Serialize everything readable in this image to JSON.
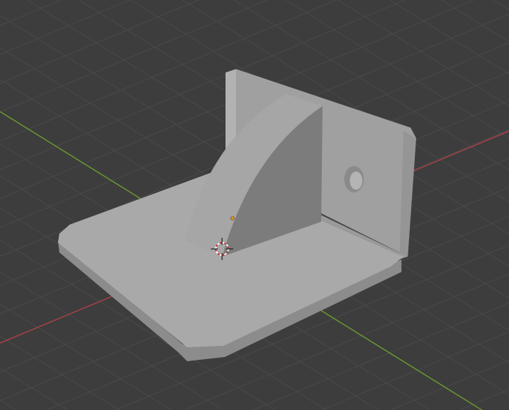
{
  "viewport": {
    "background_color": "#3d3d3d",
    "grid_color": "#4a4a4a",
    "x_axis_color": "#a8404a",
    "y_axis_color": "#6a9a30",
    "model_colors": {
      "top": "#a9a9a9",
      "side": "#8c8c8c",
      "wall": "#9e9e9e",
      "gusset_side": "#7c7c7c"
    },
    "origin_color": "#e8902a",
    "icons": [
      "origin-point-icon",
      "3d-cursor-icon"
    ]
  }
}
